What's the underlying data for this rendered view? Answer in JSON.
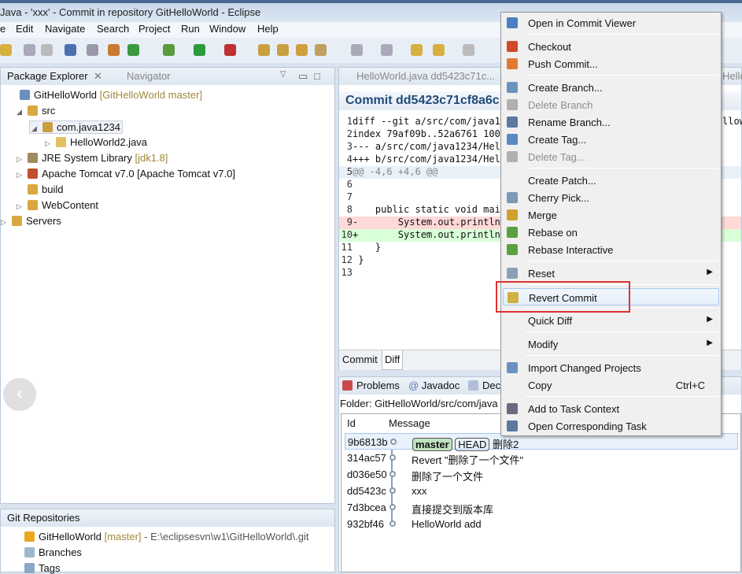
{
  "window": {
    "title": "Java - 'xxx' - Commit in repository GitHelloWorld - Eclipse"
  },
  "menubar": [
    "e",
    "Edit",
    "Navigate",
    "Search",
    "Project",
    "Run",
    "Window",
    "Help"
  ],
  "package_explorer": {
    "tab": "Package Explorer",
    "tab2": "Navigator",
    "tree": [
      {
        "label": "GitHelloWorld",
        "deco": "[GitHelloWorld master]"
      },
      {
        "label": "src",
        "deco": ""
      },
      {
        "label": "com.java1234",
        "deco": ""
      },
      {
        "label": "HelloWorld2.java",
        "deco": ""
      },
      {
        "label": "JRE System Library",
        "deco": "[jdk1.8]"
      },
      {
        "label": "Apache Tomcat v7.0 [Apache Tomcat v7.0]",
        "deco": ""
      },
      {
        "label": "build",
        "deco": ""
      },
      {
        "label": "WebContent",
        "deco": ""
      },
      {
        "label": "Servers",
        "deco": ""
      }
    ]
  },
  "git_repositories": {
    "tab": "Git Repositories",
    "repo": "GitHelloWorld",
    "branch": "[master]",
    "path": "- E:\\eclipsesvn\\w1\\GitHelloWorld\\.git",
    "children": [
      "Branches",
      "Tags"
    ]
  },
  "editor": {
    "tab": "HelloWorld.java dd5423c71c...",
    "tab_right": "Hello",
    "header": "Commit dd5423c71cf8a6c",
    "right_fragment": "llow",
    "diff": [
      {
        "n": "1",
        "t": "diff --git a/src/com/java12",
        "k": "h"
      },
      {
        "n": "2",
        "t": "index 79af09b..52a6761 1006",
        "k": "h"
      },
      {
        "n": "3",
        "t": "--- a/src/com/java1234/Hell",
        "k": "h"
      },
      {
        "n": "4",
        "t": "+++ b/src/com/java1234/Hell",
        "k": "h"
      },
      {
        "n": "5",
        "t": "@@ -4,6 +4,6 @@",
        "k": "hunk"
      },
      {
        "n": "6",
        "t": "",
        "k": ""
      },
      {
        "n": "7",
        "t": "",
        "k": ""
      },
      {
        "n": "8",
        "t": "    public static void main",
        "k": ""
      },
      {
        "n": "9",
        "t": "-       System.out.println(",
        "k": "del"
      },
      {
        "n": "10",
        "t": "+       System.out.println(",
        "k": "add"
      },
      {
        "n": "11",
        "t": "    }",
        "k": ""
      },
      {
        "n": "12",
        "t": " }",
        "k": ""
      },
      {
        "n": "13",
        "t": "",
        "k": ""
      }
    ],
    "bottom_tabs": [
      "Commit",
      "Diff"
    ]
  },
  "history": {
    "tabs": [
      "Problems",
      "Javadoc",
      "Dec"
    ],
    "folder": "Folder: GitHelloWorld/src/com/java",
    "columns": [
      "Id",
      "Message"
    ],
    "rows": [
      {
        "id": "9b6813b",
        "msg": "删除2",
        "badges": [
          "master",
          "HEAD"
        ]
      },
      {
        "id": "314ac57",
        "msg": "Revert \"删除了一个文件\""
      },
      {
        "id": "d036e50",
        "msg": "删除了一个文件"
      },
      {
        "id": "dd5423c",
        "msg": "xxx"
      },
      {
        "id": "7d3bcea",
        "msg": "直接提交到版本库"
      },
      {
        "id": "932bf46",
        "msg": "HelloWorld add"
      }
    ]
  },
  "context_menu": {
    "items": [
      {
        "label": "Open in Commit Viewer",
        "icon": "commit-viewer-icon",
        "c": "#4b7fc4"
      },
      {
        "sep": true
      },
      {
        "label": "Checkout",
        "icon": "checkout-icon",
        "c": "#d04a2a"
      },
      {
        "label": "Push Commit...",
        "icon": "push-icon",
        "c": "#e07a30"
      },
      {
        "sep": true
      },
      {
        "label": "Create Branch...",
        "icon": "create-branch-icon",
        "c": "#6a93c0"
      },
      {
        "label": "Delete Branch",
        "icon": "delete-icon",
        "c": "#b0b0b0",
        "disabled": true
      },
      {
        "label": "Rename Branch...",
        "icon": "rename-icon",
        "c": "#5a7aa0"
      },
      {
        "label": "Create Tag...",
        "icon": "tag-icon",
        "c": "#5a8ac0"
      },
      {
        "label": "Delete Tag...",
        "icon": "delete-icon",
        "c": "#b0b0b0",
        "disabled": true
      },
      {
        "sep": true
      },
      {
        "label": "Create Patch...",
        "icon": "",
        "c": ""
      },
      {
        "label": "Cherry Pick...",
        "icon": "cherry-pick-icon",
        "c": "#7a9ab8"
      },
      {
        "label": "Merge",
        "icon": "merge-icon",
        "c": "#d0a030"
      },
      {
        "label": "Rebase on",
        "icon": "rebase-icon",
        "c": "#5aa040"
      },
      {
        "label": "Rebase Interactive",
        "icon": "rebase-interactive-icon",
        "c": "#5aa040"
      },
      {
        "sep": true
      },
      {
        "label": "Reset",
        "icon": "reset-icon",
        "c": "#8aa0b8",
        "submenu": true
      },
      {
        "sep": true
      },
      {
        "label": "Revert Commit",
        "icon": "revert-icon",
        "c": "#d0b040",
        "highlight": true
      },
      {
        "sep": true
      },
      {
        "label": "Quick Diff",
        "icon": "",
        "c": "",
        "submenu": true
      },
      {
        "sep": true
      },
      {
        "label": "Modify",
        "icon": "",
        "c": "",
        "submenu": true
      },
      {
        "sep": true
      },
      {
        "label": "Import Changed Projects",
        "icon": "import-icon",
        "c": "#6a90c0"
      },
      {
        "label": "Copy",
        "icon": "",
        "c": "",
        "accel": "Ctrl+C"
      },
      {
        "sep": true
      },
      {
        "label": "Add to Task Context",
        "icon": "task-context-icon",
        "c": "#6a6a80"
      },
      {
        "label": "Open Corresponding Task",
        "icon": "task-icon",
        "c": "#5a7aa0"
      }
    ]
  },
  "colors": {
    "highlight_box": "#e03030",
    "diff_del": "#ffd8d8",
    "diff_add": "#d8ffd8",
    "header": "#1f4b7a"
  }
}
